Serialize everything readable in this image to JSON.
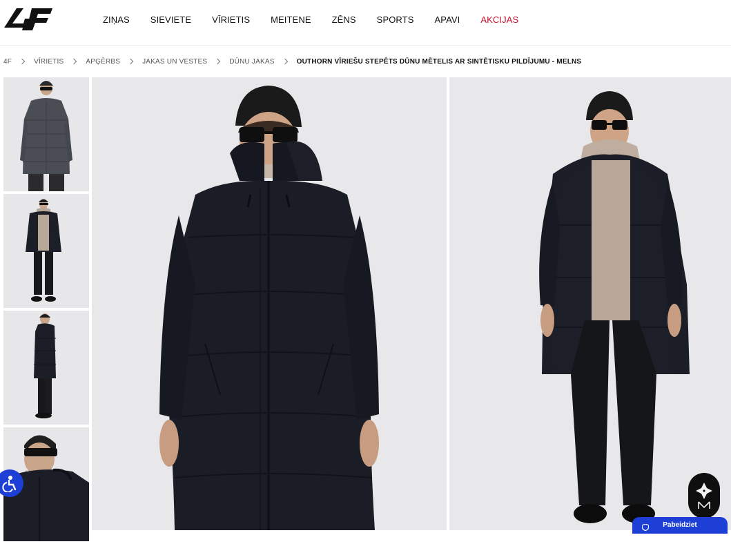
{
  "brand": {
    "logo_text": "4F"
  },
  "nav": {
    "items": [
      {
        "label": "ZIŅAS"
      },
      {
        "label": "SIEVIETE"
      },
      {
        "label": "VĪRIETIS"
      },
      {
        "label": "MEITENE"
      },
      {
        "label": "ZĒNS"
      },
      {
        "label": "SPORTS"
      },
      {
        "label": "APAVI"
      },
      {
        "label": "AKCIJAS"
      }
    ],
    "sale_color": "#c8102e"
  },
  "breadcrumb": {
    "items": [
      {
        "label": "4F"
      },
      {
        "label": "VĪRIETIS"
      },
      {
        "label": "APĢĒRBS"
      },
      {
        "label": "JAKAS UN VESTES"
      },
      {
        "label": "DŪNU JAKAS"
      }
    ],
    "current": "OUTHORN VĪRIEŠU STEPĒTS DŪNU MĒTELIS AR SINTĒTISKU PILDĪJUMU - MELNS"
  },
  "gallery": {
    "thumbnails": [
      {
        "icon": "product-thumbnail-front"
      },
      {
        "icon": "product-thumbnail-full-body"
      },
      {
        "icon": "product-thumbnail-side"
      },
      {
        "icon": "product-thumbnail-closeup"
      }
    ],
    "main_images": [
      {
        "icon": "product-photo-front"
      },
      {
        "icon": "product-photo-full-body"
      }
    ]
  },
  "widgets": {
    "accessibility_icon": "accessibility-icon",
    "chat_icon": "brand-widget-icon",
    "finish_label": "Pabeidziet",
    "accent": "#1d3fd6"
  }
}
